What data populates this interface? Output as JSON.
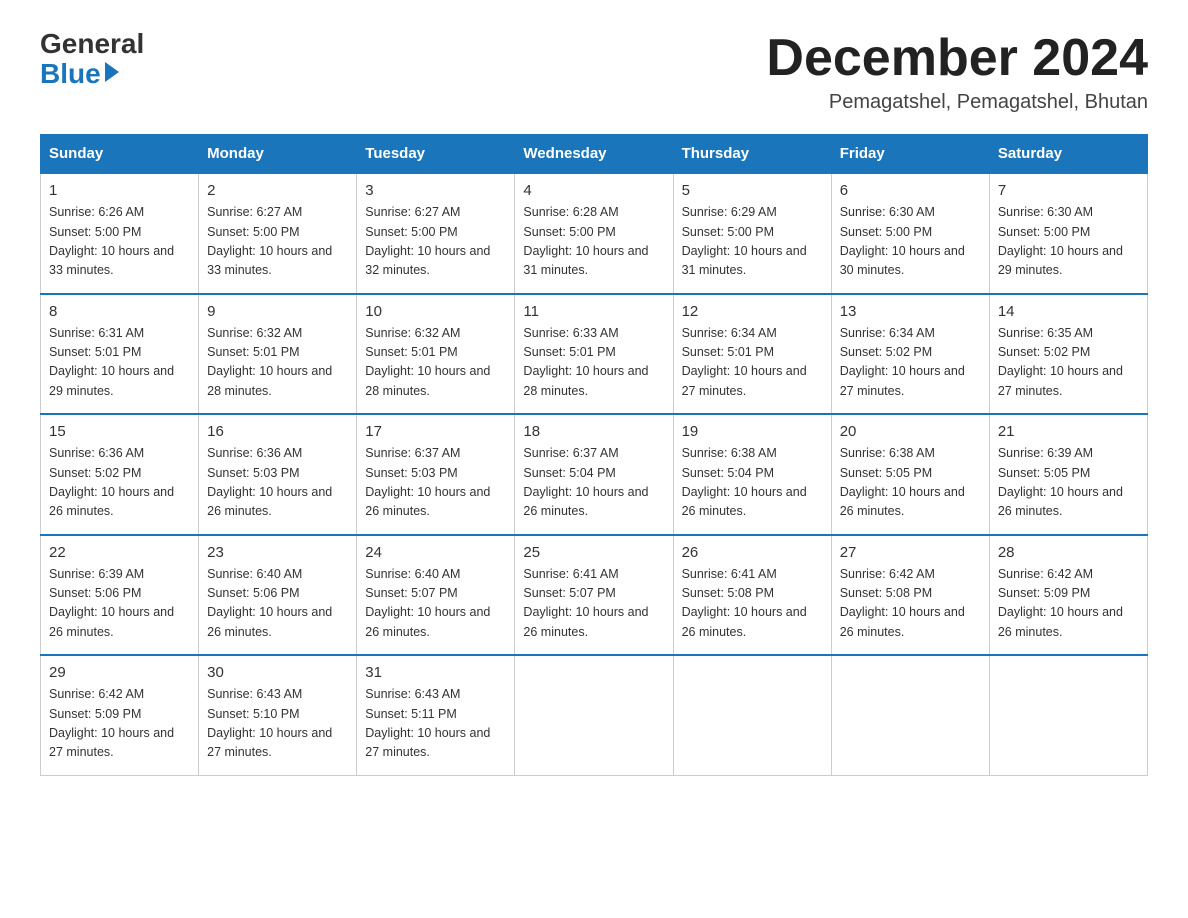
{
  "header": {
    "logo_general": "General",
    "logo_blue": "Blue",
    "month_title": "December 2024",
    "location": "Pemagatshel, Pemagatshel, Bhutan"
  },
  "weekdays": [
    "Sunday",
    "Monday",
    "Tuesday",
    "Wednesday",
    "Thursday",
    "Friday",
    "Saturday"
  ],
  "weeks": [
    [
      {
        "day": "1",
        "sunrise": "6:26 AM",
        "sunset": "5:00 PM",
        "daylight": "10 hours and 33 minutes."
      },
      {
        "day": "2",
        "sunrise": "6:27 AM",
        "sunset": "5:00 PM",
        "daylight": "10 hours and 33 minutes."
      },
      {
        "day": "3",
        "sunrise": "6:27 AM",
        "sunset": "5:00 PM",
        "daylight": "10 hours and 32 minutes."
      },
      {
        "day": "4",
        "sunrise": "6:28 AM",
        "sunset": "5:00 PM",
        "daylight": "10 hours and 31 minutes."
      },
      {
        "day": "5",
        "sunrise": "6:29 AM",
        "sunset": "5:00 PM",
        "daylight": "10 hours and 31 minutes."
      },
      {
        "day": "6",
        "sunrise": "6:30 AM",
        "sunset": "5:00 PM",
        "daylight": "10 hours and 30 minutes."
      },
      {
        "day": "7",
        "sunrise": "6:30 AM",
        "sunset": "5:00 PM",
        "daylight": "10 hours and 29 minutes."
      }
    ],
    [
      {
        "day": "8",
        "sunrise": "6:31 AM",
        "sunset": "5:01 PM",
        "daylight": "10 hours and 29 minutes."
      },
      {
        "day": "9",
        "sunrise": "6:32 AM",
        "sunset": "5:01 PM",
        "daylight": "10 hours and 28 minutes."
      },
      {
        "day": "10",
        "sunrise": "6:32 AM",
        "sunset": "5:01 PM",
        "daylight": "10 hours and 28 minutes."
      },
      {
        "day": "11",
        "sunrise": "6:33 AM",
        "sunset": "5:01 PM",
        "daylight": "10 hours and 28 minutes."
      },
      {
        "day": "12",
        "sunrise": "6:34 AM",
        "sunset": "5:01 PM",
        "daylight": "10 hours and 27 minutes."
      },
      {
        "day": "13",
        "sunrise": "6:34 AM",
        "sunset": "5:02 PM",
        "daylight": "10 hours and 27 minutes."
      },
      {
        "day": "14",
        "sunrise": "6:35 AM",
        "sunset": "5:02 PM",
        "daylight": "10 hours and 27 minutes."
      }
    ],
    [
      {
        "day": "15",
        "sunrise": "6:36 AM",
        "sunset": "5:02 PM",
        "daylight": "10 hours and 26 minutes."
      },
      {
        "day": "16",
        "sunrise": "6:36 AM",
        "sunset": "5:03 PM",
        "daylight": "10 hours and 26 minutes."
      },
      {
        "day": "17",
        "sunrise": "6:37 AM",
        "sunset": "5:03 PM",
        "daylight": "10 hours and 26 minutes."
      },
      {
        "day": "18",
        "sunrise": "6:37 AM",
        "sunset": "5:04 PM",
        "daylight": "10 hours and 26 minutes."
      },
      {
        "day": "19",
        "sunrise": "6:38 AM",
        "sunset": "5:04 PM",
        "daylight": "10 hours and 26 minutes."
      },
      {
        "day": "20",
        "sunrise": "6:38 AM",
        "sunset": "5:05 PM",
        "daylight": "10 hours and 26 minutes."
      },
      {
        "day": "21",
        "sunrise": "6:39 AM",
        "sunset": "5:05 PM",
        "daylight": "10 hours and 26 minutes."
      }
    ],
    [
      {
        "day": "22",
        "sunrise": "6:39 AM",
        "sunset": "5:06 PM",
        "daylight": "10 hours and 26 minutes."
      },
      {
        "day": "23",
        "sunrise": "6:40 AM",
        "sunset": "5:06 PM",
        "daylight": "10 hours and 26 minutes."
      },
      {
        "day": "24",
        "sunrise": "6:40 AM",
        "sunset": "5:07 PM",
        "daylight": "10 hours and 26 minutes."
      },
      {
        "day": "25",
        "sunrise": "6:41 AM",
        "sunset": "5:07 PM",
        "daylight": "10 hours and 26 minutes."
      },
      {
        "day": "26",
        "sunrise": "6:41 AM",
        "sunset": "5:08 PM",
        "daylight": "10 hours and 26 minutes."
      },
      {
        "day": "27",
        "sunrise": "6:42 AM",
        "sunset": "5:08 PM",
        "daylight": "10 hours and 26 minutes."
      },
      {
        "day": "28",
        "sunrise": "6:42 AM",
        "sunset": "5:09 PM",
        "daylight": "10 hours and 26 minutes."
      }
    ],
    [
      {
        "day": "29",
        "sunrise": "6:42 AM",
        "sunset": "5:09 PM",
        "daylight": "10 hours and 27 minutes."
      },
      {
        "day": "30",
        "sunrise": "6:43 AM",
        "sunset": "5:10 PM",
        "daylight": "10 hours and 27 minutes."
      },
      {
        "day": "31",
        "sunrise": "6:43 AM",
        "sunset": "5:11 PM",
        "daylight": "10 hours and 27 minutes."
      },
      null,
      null,
      null,
      null
    ]
  ]
}
